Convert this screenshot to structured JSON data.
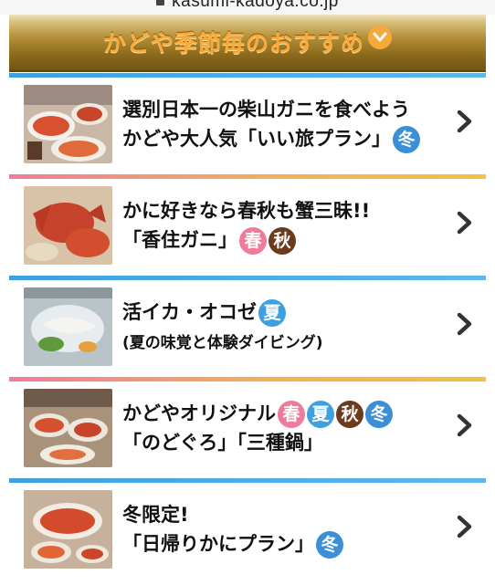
{
  "browser": {
    "url": "kasumi-kadoya.co.jp"
  },
  "header": {
    "title": "かどや季節毎のおすすめ"
  },
  "colors": {
    "winter": "#3a8fd6",
    "spring": "#ec7c9a",
    "summer": "#3fa0e0",
    "autumn": "#6b3b1e",
    "header_gold": "#b08c33",
    "header_text": "#f7a93a"
  },
  "items": [
    {
      "line1": "選別日本一の柴山ガニを食べよう",
      "line2": "かどや大人気「いい旅プラン」",
      "badges": [
        "冬"
      ],
      "thumbnail_icon": "crab-dish-photo"
    },
    {
      "line1": "かに好きなら春秋も蟹三昧!!",
      "line2": "「香住ガニ」",
      "badges": [
        "春",
        "秋"
      ],
      "thumbnail_icon": "red-crab-photo"
    },
    {
      "line1": "活イカ・オコゼ",
      "line2": "(夏の味覚と体験ダイビング)",
      "badges": [
        "夏"
      ],
      "thumbnail_icon": "squid-sashimi-photo"
    },
    {
      "line1": "かどやオリジナル",
      "line2": "「のどぐろ」「三種鍋」",
      "badges": [
        "春",
        "夏",
        "秋",
        "冬"
      ],
      "thumbnail_icon": "crab-course-photo"
    },
    {
      "line1": "冬限定!",
      "line2": "「日帰りかにプラン」",
      "badges": [
        "冬"
      ],
      "thumbnail_icon": "crab-platter-photo"
    }
  ]
}
